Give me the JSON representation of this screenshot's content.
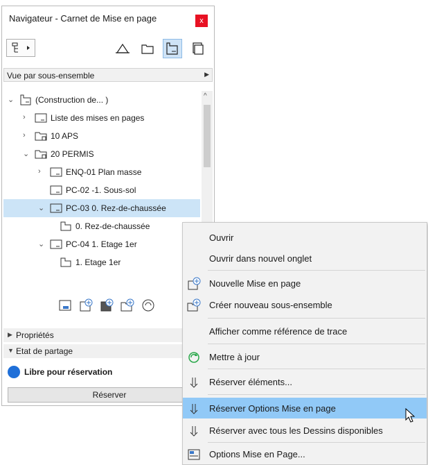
{
  "panel": {
    "title": "Navigateur - Carnet de Mise en page",
    "close_label": "x",
    "view_dropdown": "Vue par sous-ensemble"
  },
  "tree": [
    {
      "label": "(Construction de... )",
      "expander": "v"
    },
    {
      "label": "Liste des mises en pages",
      "expander": ">"
    },
    {
      "label": "10 APS",
      "expander": ">"
    },
    {
      "label": "20 PERMIS",
      "expander": "v"
    },
    {
      "label": "ENQ-01 Plan masse",
      "expander": ">"
    },
    {
      "label": "PC-02 -1. Sous-sol",
      "expander": ""
    },
    {
      "label": "PC-03 0. Rez-de-chaussée",
      "expander": "v"
    },
    {
      "label": "0. Rez-de-chaussée",
      "expander": ""
    },
    {
      "label": "PC-04 1. Etage 1er",
      "expander": "v"
    },
    {
      "label": "1. Etage 1er",
      "expander": ""
    }
  ],
  "sections": {
    "properties": "Propriétés",
    "share_state": "Etat de partage"
  },
  "status": {
    "text": "Libre pour réservation",
    "color": "#1f6fd8"
  },
  "reserve_button": "Réserver",
  "context_menu": {
    "items": [
      {
        "label": "Ouvrir",
        "icon": ""
      },
      {
        "label": "Ouvrir dans nouvel onglet",
        "icon": ""
      },
      {
        "label": "Nouvelle Mise en page",
        "icon": "new-layout-icon"
      },
      {
        "label": "Créer nouveau sous-ensemble",
        "icon": "new-subset-icon"
      },
      {
        "label": "Afficher comme référence de trace",
        "icon": ""
      },
      {
        "label": "Mettre à jour",
        "icon": "refresh-icon"
      },
      {
        "label": "Réserver éléments...",
        "icon": "reserve-arrow-icon"
      },
      {
        "label": "Réserver Options Mise en page",
        "icon": "reserve-arrow-icon"
      },
      {
        "label": "Réserver avec tous les Dessins disponibles",
        "icon": "reserve-arrow-icon"
      },
      {
        "label": "Options Mise en Page...",
        "icon": "layout-options-icon"
      }
    ],
    "hover_color": "#91c9f7"
  }
}
